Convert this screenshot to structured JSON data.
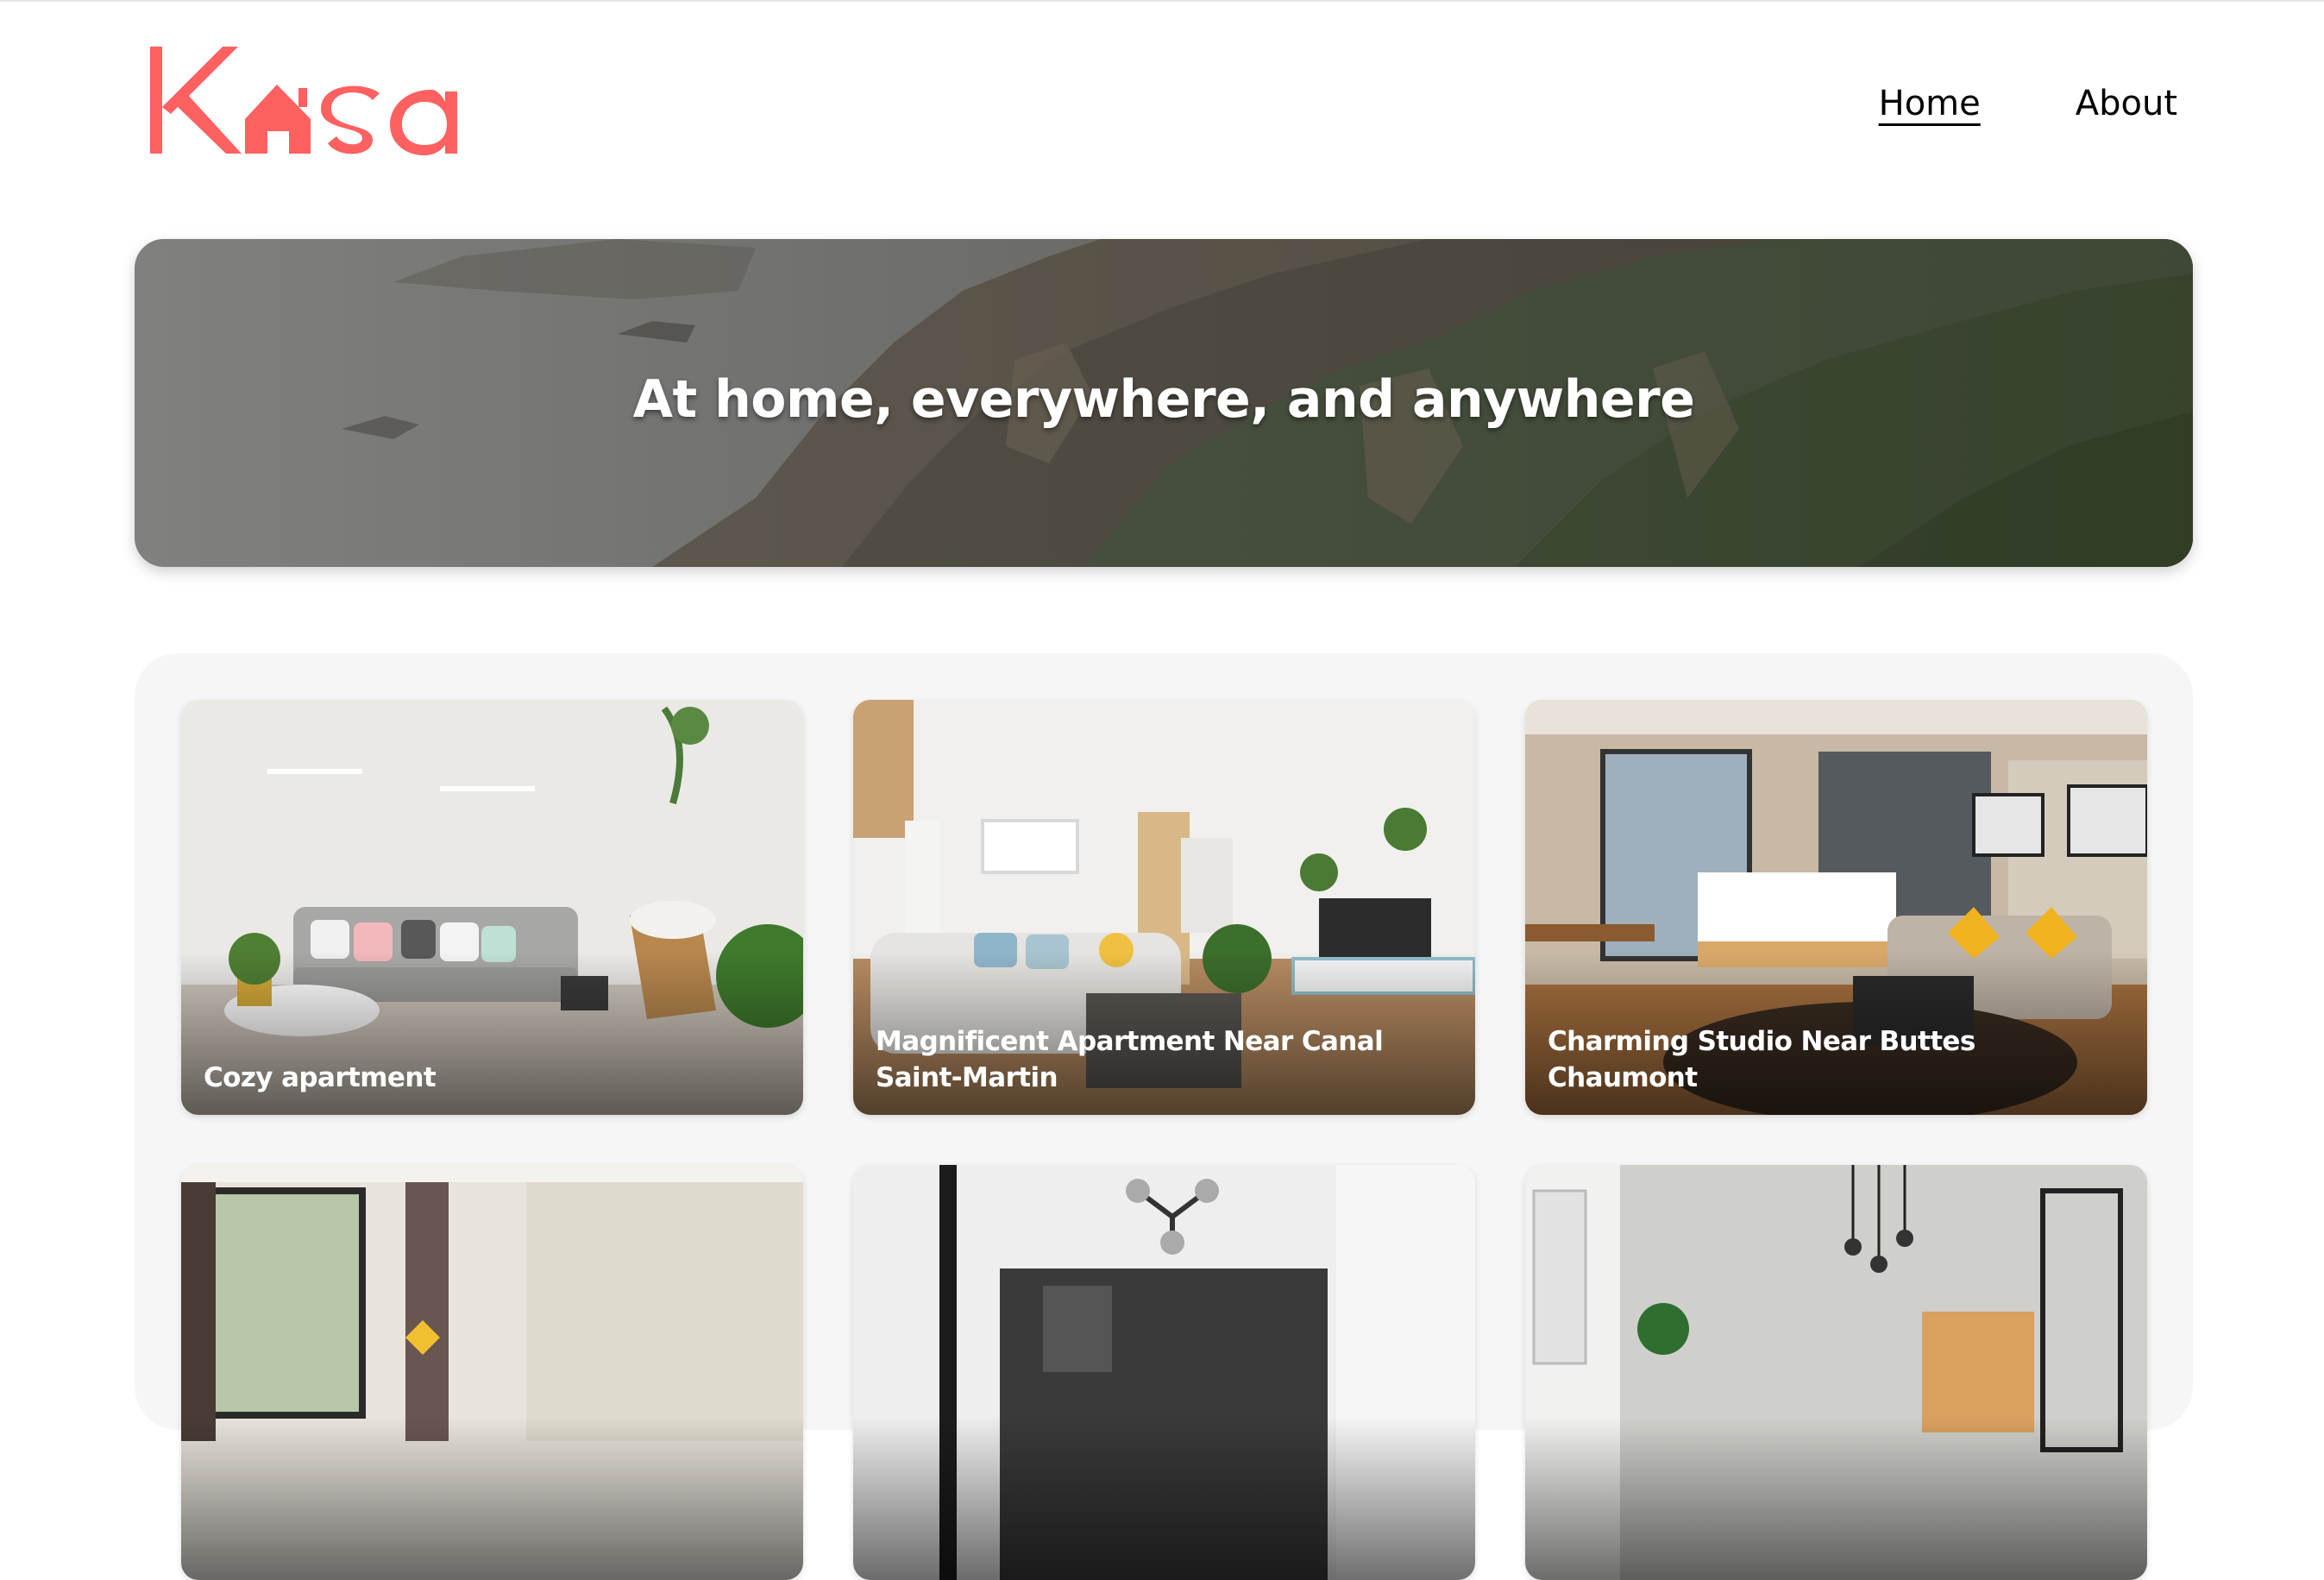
{
  "header": {
    "logo_text": "Kasa",
    "logo_color": "#FF6060",
    "nav": [
      {
        "label": "Home",
        "active": true
      },
      {
        "label": "About",
        "active": false
      }
    ]
  },
  "hero": {
    "title": "At home, everywhere, and anywhere"
  },
  "listings": [
    {
      "title": "Cozy apartment"
    },
    {
      "title": "Magnificent Apartment Near Canal Saint-Martin"
    },
    {
      "title": "Charming Studio Near Buttes Chaumont"
    },
    {
      "title": ""
    },
    {
      "title": ""
    },
    {
      "title": ""
    }
  ]
}
